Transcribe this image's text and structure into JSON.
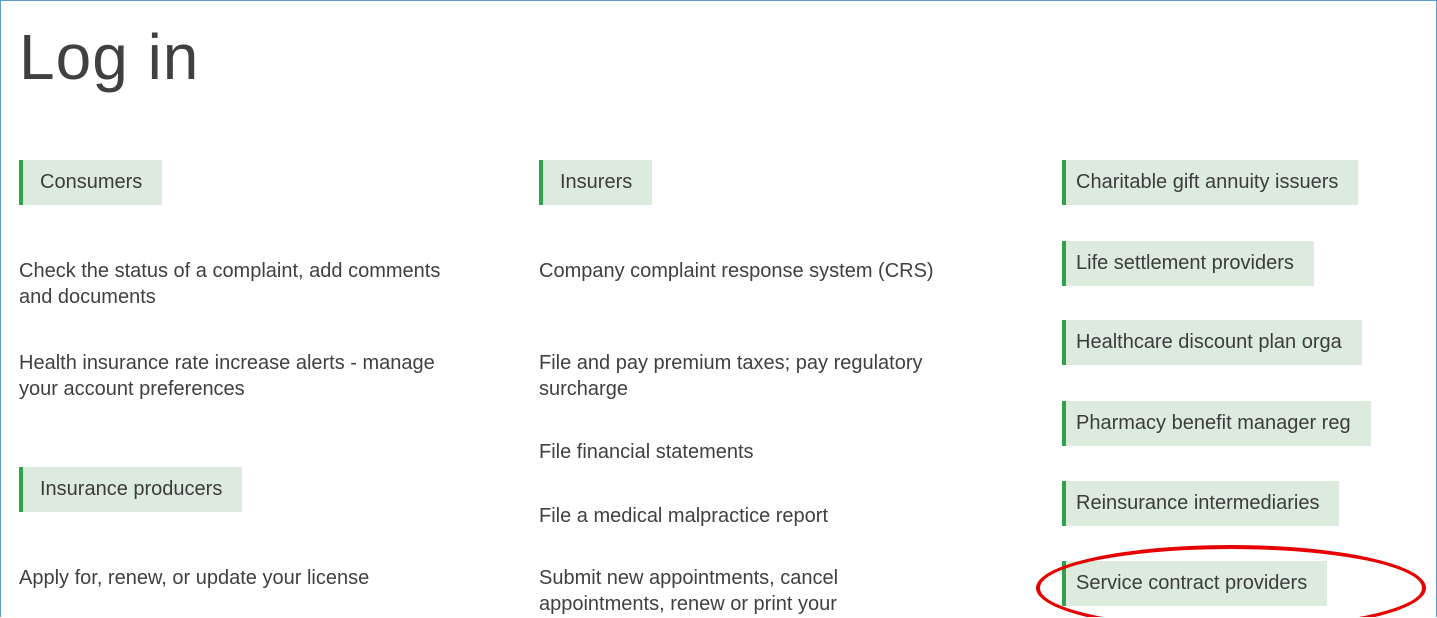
{
  "page_title": "Log in",
  "consumers": {
    "heading": "Consumers",
    "links": [
      "Check the status of a complaint, add comments and documents",
      "Health insurance rate increase alerts - manage your account preferences"
    ]
  },
  "producers": {
    "heading": "Insurance producers",
    "links": [
      "Apply for, renew, or update your license"
    ]
  },
  "insurers": {
    "heading": "Insurers",
    "links": [
      "Company complaint response system (CRS)",
      "File and pay premium taxes; pay regulatory surcharge",
      "File financial statements",
      "File a medical malpractice report",
      "Submit new appointments, cancel appointments, renew or print your"
    ]
  },
  "entities": [
    "Charitable gift annuity issuers",
    "Life settlement providers",
    "Healthcare discount plan orga",
    "Pharmacy benefit manager reg",
    "Reinsurance intermediaries",
    "Service contract providers"
  ],
  "colors": {
    "heading_bg": "#dcebdd",
    "heading_accent": "#2fa24a",
    "frame_border": "#5b9bd5",
    "highlight": "#e60000"
  }
}
